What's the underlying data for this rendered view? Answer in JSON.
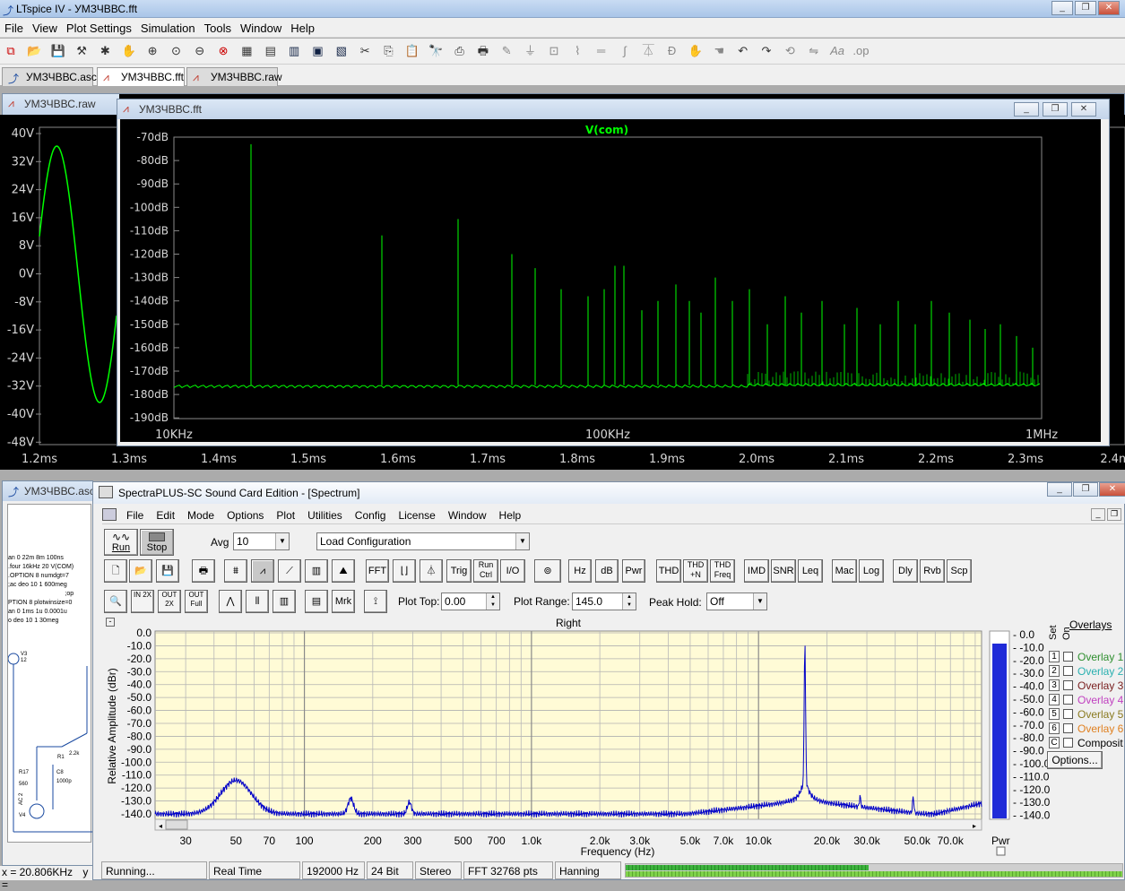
{
  "app": {
    "title": "LTspice IV - УМЗЧВВС.fft"
  },
  "menu": [
    "File",
    "View",
    "Plot Settings",
    "Simulation",
    "Tools",
    "Window",
    "Help"
  ],
  "tabs": [
    {
      "label": "УМЗЧВВС.asc"
    },
    {
      "label": "УМЗЧВВС.fft"
    },
    {
      "label": "УМЗЧВВС.raw"
    }
  ],
  "raw": {
    "title": "УМЗЧВВС.raw",
    "y_ticks": [
      "40V",
      "32V",
      "24V",
      "16V",
      "8V",
      "0V",
      "-8V",
      "-16V",
      "-24V",
      "-32V",
      "-40V",
      "-48V"
    ],
    "x_ticks": [
      "1.2ms",
      "1.3ms",
      "1.4ms",
      "1.5ms",
      "1.6ms",
      "1.7ms",
      "1.8ms",
      "1.9ms",
      "2.0ms",
      "2.1ms",
      "2.2ms",
      "2.3ms",
      "2.4m"
    ],
    "color": "#00ff00"
  },
  "fft": {
    "title": "УМЗЧВВС.fft",
    "trace": "V(com)",
    "y_ticks": [
      "-70dB",
      "-80dB",
      "-90dB",
      "-100dB",
      "-110dB",
      "-120dB",
      "-130dB",
      "-140dB",
      "-150dB",
      "-160dB",
      "-170dB",
      "-180dB",
      "-190dB"
    ],
    "x_ticks": [
      "10KHz",
      "100KHz",
      "1MHz"
    ],
    "color": "#00ff00"
  },
  "asc_win": {
    "title": "УМЗЧВВС.asc",
    "lines": [
      "an 0 22m 8m 100ns",
      ".four 16kHz 20 V(COM)",
      ".OPTION 8 numdgt=7",
      ";ac deo 10 1 600meg",
      ";op",
      "PTION 8 plotwinsize=0",
      "an 0 1ms 1u 0.0001u",
      "o deo 10 1 30meg"
    ],
    "labels": [
      "V3",
      "12",
      "R1",
      "2.2k",
      "R17",
      "560",
      "C8",
      "1000p",
      "V4",
      "AC 2"
    ]
  },
  "status": {
    "cursor": "x = 20.806KHz",
    "y": "y ="
  },
  "spectra": {
    "title": "SpectraPLUS-SC Sound Card Edition - [Spectrum]",
    "menu": [
      "File",
      "Edit",
      "Mode",
      "Options",
      "Plot",
      "Utilities",
      "Config",
      "License",
      "Window",
      "Help"
    ],
    "run_label": "Run",
    "stop_label": "Stop",
    "avg_label": "Avg",
    "avg_value": "10",
    "load_config": "Load Configuration",
    "buttons_row1": [
      "FFT",
      "Trig",
      "Run Ctrl",
      "I/O",
      "Hz",
      "dB",
      "Pwr",
      "THD",
      "THD +N",
      "THD Freq",
      "IMD",
      "SNR",
      "Leq",
      "Mac",
      "Log",
      "Dly",
      "Rvb",
      "Scp"
    ],
    "zoom_buttons": [
      "IN 2X",
      "OUT 2X",
      "OUT Full"
    ],
    "mrk_label": "Mrk",
    "plot_top_label": "Plot Top:",
    "plot_top_value": "0.00",
    "plot_range_label": "Plot Range:",
    "plot_range_value": "145.0",
    "peak_hold_label": "Peak Hold:",
    "peak_hold_value": "Off",
    "channel": "Right",
    "ylabel": "Relative Amplitude (dBr)",
    "xlabel": "Frequency (Hz)",
    "y_ticks": [
      "0.0",
      "-10.0",
      "-20.0",
      "-30.0",
      "-40.0",
      "-50.0",
      "-60.0",
      "-70.0",
      "-80.0",
      "-90.0",
      "-100.0",
      "-110.0",
      "-120.0",
      "-130.0",
      "-140.0"
    ],
    "x_ticks": [
      "30",
      "50",
      "70",
      "100",
      "200",
      "300",
      "500",
      "700",
      "1.0k",
      "2.0k",
      "3.0k",
      "5.0k",
      "7.0k",
      "10.0k",
      "20.0k",
      "30.0k",
      "50.0k",
      "70.0k"
    ],
    "pwr_label": "Pwr",
    "meter_ticks": [
      "0.0",
      "-10.0",
      "-20.0",
      "-30.0",
      "-40.0",
      "-50.0",
      "-60.0",
      "-70.0",
      "-80.0",
      "-90.0",
      "-100.0",
      "-110.0",
      "-120.0",
      "-130.0",
      "-140.0"
    ],
    "overlays_title": "Overlays",
    "set_on": [
      "Set",
      "On"
    ],
    "overlays": [
      {
        "n": "1",
        "name": "Overlay 1",
        "color": "#2f8f2f"
      },
      {
        "n": "2",
        "name": "Overlay 2",
        "color": "#2ab0b0"
      },
      {
        "n": "3",
        "name": "Overlay 3",
        "color": "#7a2020"
      },
      {
        "n": "4",
        "name": "Overlay 4",
        "color": "#c040c0"
      },
      {
        "n": "5",
        "name": "Overlay 5",
        "color": "#8a7a20"
      },
      {
        "n": "6",
        "name": "Overlay 6",
        "color": "#e08020"
      },
      {
        "n": "C",
        "name": "Composit",
        "color": "#000000"
      }
    ],
    "options_label": "Options...",
    "status": [
      "Running...",
      "Real Time",
      "192000 Hz",
      "24 Bit",
      "Stereo",
      "FFT 32768 pts",
      "Hanning"
    ],
    "trace_color": "#0000c8"
  }
}
